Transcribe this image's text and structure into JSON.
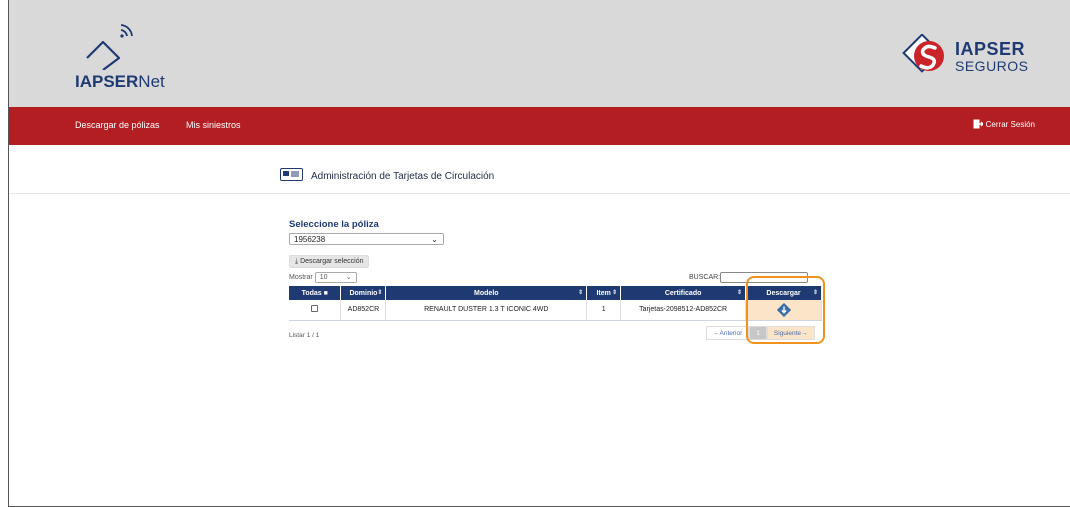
{
  "header": {
    "app_logo_bold": "IAPSER",
    "app_logo_light": "Net",
    "brand_line1": "IAPSER",
    "brand_line2": "SEGUROS",
    "brand_color": "#1f3a72"
  },
  "nav": {
    "items": [
      {
        "label": "Descargar de pólizas"
      },
      {
        "label": "Mis siniestros"
      }
    ],
    "logout_label": "Cerrar Sesión",
    "bar_color": "#b21e22"
  },
  "page": {
    "title": "Administración de Tarjetas de Circulación",
    "title_icon": "id-card-icon"
  },
  "policy": {
    "label": "Seleccione la póliza",
    "selected": "1956238",
    "download_selection_label": "Descargar selección"
  },
  "table_controls": {
    "show_label": "Mostrar",
    "page_length": "10",
    "search_label": "BUSCAR:",
    "search_value": ""
  },
  "table": {
    "headers": [
      "Todas",
      "Dominio",
      "Modelo",
      "Item",
      "Certificado",
      "Descargar"
    ],
    "rows": [
      {
        "checked": false,
        "dominio": "AD852CR",
        "modelo": "RENAULT DUSTER 1.3 T ICONIC 4WD",
        "item": "1",
        "certificado": "Tarjetas-2098512-AD852CR",
        "download_icon": "download-icon"
      }
    ]
  },
  "footer": {
    "listing": "Listar 1 / 1",
    "prev_label": "Anterior",
    "current_page": "1",
    "next_label": "Siguiente"
  },
  "highlight_color": "#f0931e"
}
